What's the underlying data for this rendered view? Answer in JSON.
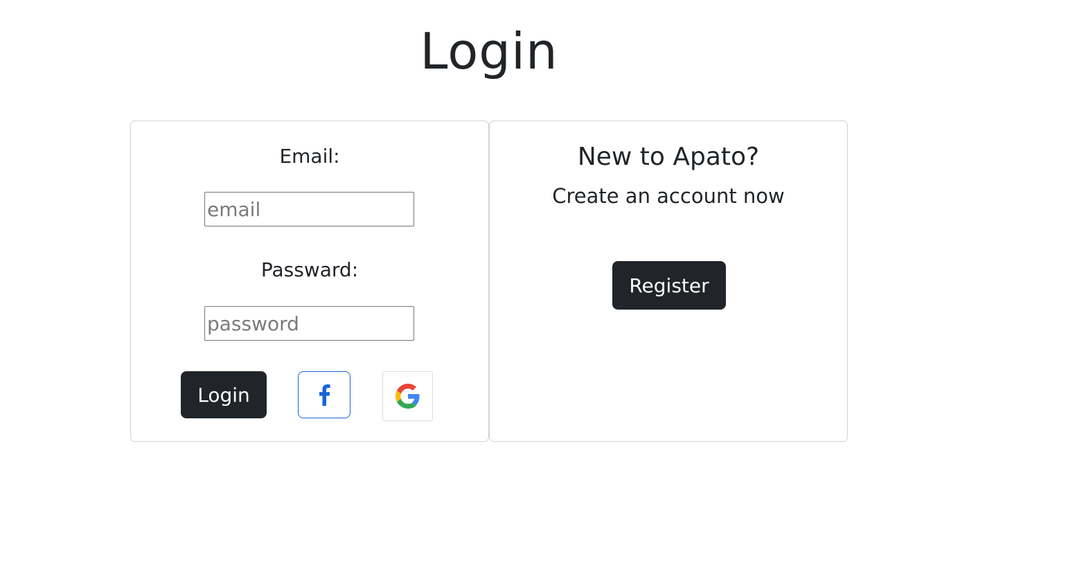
{
  "page": {
    "title": "Login"
  },
  "login_form": {
    "email_label": "Email:",
    "email_placeholder": "email",
    "email_value": "",
    "password_label": "Passward:",
    "password_placeholder": "password",
    "password_value": "",
    "login_button": "Login",
    "facebook_icon": "facebook-f-icon",
    "google_icon": "google-g-icon"
  },
  "register_panel": {
    "heading": "New to Apato?",
    "subtext": "Create an account now",
    "register_button": "Register"
  },
  "colors": {
    "primary_dark": "#212529",
    "facebook_blue": "#1a63d9",
    "google_blue": "#4285F4",
    "google_red": "#EA4335",
    "google_yellow": "#FBBC05",
    "google_green": "#34A853"
  }
}
